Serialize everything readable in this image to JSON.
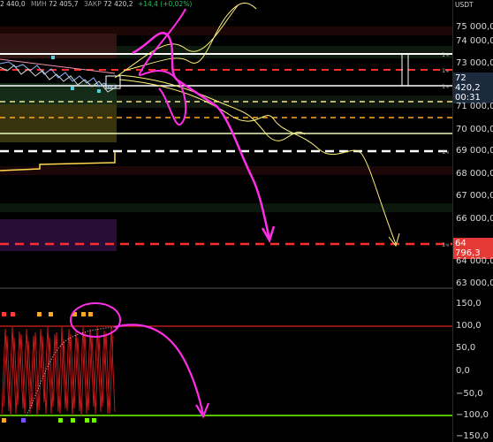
{
  "ohlc": {
    "open_fragment": "2 440,0",
    "low_label": "МИН",
    "low_value": "72 405,7",
    "close_label": "ЗАКР",
    "close_value": "72 420,2",
    "change": "+14,4 (+0,02%)"
  },
  "price_axis": {
    "unit": "USDT",
    "ticks": [
      "75 000,0",
      "74 000,0",
      "73 000,0",
      "71 000,0",
      "70 000,0",
      "69 000,0",
      "68 000,0",
      "67 000,0",
      "66 000,0",
      "64 000,0",
      "63 000,0"
    ],
    "current_price": "72 420,2",
    "countdown": "00:31",
    "marked_level": "64 796,3"
  },
  "level_tags": [
    "1ч",
    "1ч",
    "1ч",
    "1ч",
    "1ч"
  ],
  "oscillator_axis": {
    "ticks": [
      "150,0",
      "100,0",
      "50,0",
      "0,0",
      "−50,0",
      "−100,0",
      "−150,0"
    ]
  },
  "colors": {
    "background": "#000000",
    "red_level": "#ff2d2d",
    "orange_level": "#ffa726",
    "yellow_drawing": "#fff27a",
    "magenta_drawing": "#ff2ee6",
    "oscillator_line": "#d11b1b",
    "overbought_line": "#b71c1c",
    "oversold_line": "#76ff03",
    "price_box": "#1b2a3d",
    "marked_box": "#e53935"
  }
}
